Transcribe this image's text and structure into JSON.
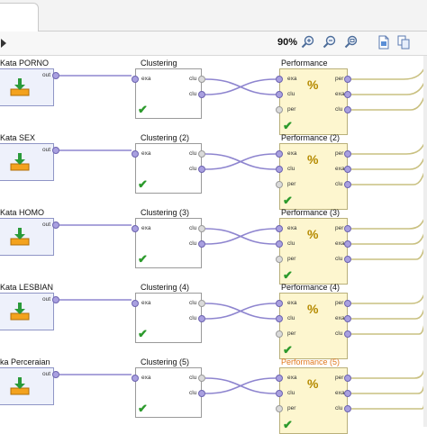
{
  "toolbar": {
    "zoom": "90%"
  },
  "rows": [
    {
      "retrieve_title": "Kata PORNO",
      "clustering_title": "Clustering",
      "performance_title": "Performance",
      "highlight": false
    },
    {
      "retrieve_title": "Kata SEX",
      "clustering_title": "Clustering (2)",
      "performance_title": "Performance (2)",
      "highlight": false
    },
    {
      "retrieve_title": "Kata HOMO",
      "clustering_title": "Clustering (3)",
      "performance_title": "Performance (3)",
      "highlight": false
    },
    {
      "retrieve_title": "Kata LESBIAN",
      "clustering_title": "Clustering (4)",
      "performance_title": "Performance (4)",
      "highlight": false
    },
    {
      "retrieve_title": "ka Perceraian",
      "clustering_title": "Clustering (5)",
      "performance_title": "Performance (5)",
      "highlight": true
    }
  ],
  "ports": {
    "retrieve_out": "out",
    "clustering_in": "exa",
    "clustering_out1": "clu",
    "clustering_out2": "clu",
    "perf_in1": "exa",
    "perf_in2": "clu",
    "perf_in3": "per",
    "perf_out1": "per",
    "perf_out2": "exa",
    "perf_out3": "clu",
    "perf_symbol": "%"
  },
  "colors": {
    "wire": "#8e85cf",
    "perf_out_wire": "#c9c080",
    "check": "#2c9a2c",
    "highlight_title": "#e0771d"
  },
  "icons": [
    "play-icon",
    "zoom-in-icon",
    "zoom-out-icon",
    "zoom-fit-icon",
    "document-icon",
    "copy-icon",
    "download-icon",
    "check-icon",
    "percent-icon"
  ]
}
